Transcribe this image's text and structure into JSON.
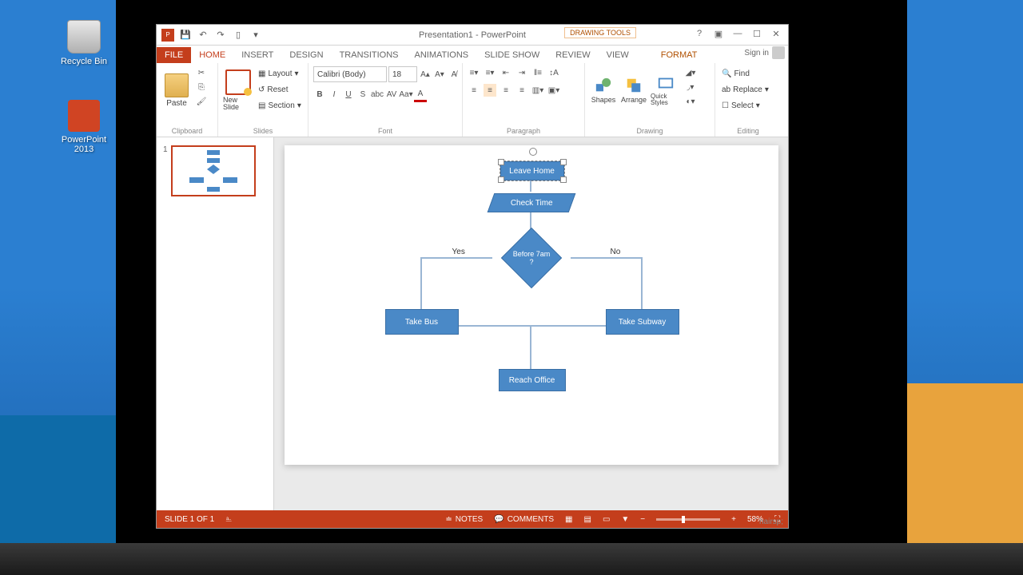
{
  "desktop": {
    "recycle_bin": "Recycle Bin",
    "powerpoint": "PowerPoint 2013"
  },
  "window": {
    "title": "Presentation1 - PowerPoint",
    "context_tools": "DRAWING TOOLS",
    "sign_in": "Sign in"
  },
  "tabs": {
    "file": "FILE",
    "home": "HOME",
    "insert": "INSERT",
    "design": "DESIGN",
    "transitions": "TRANSITIONS",
    "animations": "ANIMATIONS",
    "slideshow": "SLIDE SHOW",
    "review": "REVIEW",
    "view": "VIEW",
    "format": "FORMAT"
  },
  "ribbon": {
    "clipboard": {
      "label": "Clipboard",
      "paste": "Paste"
    },
    "slides": {
      "label": "Slides",
      "new_slide": "New Slide",
      "layout": "Layout",
      "reset": "Reset",
      "section": "Section"
    },
    "font": {
      "label": "Font",
      "name": "Calibri (Body)",
      "size": "18"
    },
    "paragraph": {
      "label": "Paragraph"
    },
    "drawing": {
      "label": "Drawing",
      "shapes": "Shapes",
      "arrange": "Arrange",
      "quick_styles": "Quick Styles"
    },
    "editing": {
      "label": "Editing",
      "find": "Find",
      "replace": "Replace",
      "select": "Select"
    }
  },
  "thumb": {
    "number": "1"
  },
  "flowchart": {
    "start": "Leave Home",
    "check": "Check Time",
    "decision": "Before 7am ?",
    "yes": "Yes",
    "no": "No",
    "left": "Take Bus",
    "right": "Take Subway",
    "end": "Reach Office"
  },
  "status": {
    "slide": "SLIDE 1 OF 1",
    "notes": "NOTES",
    "comments": "COMMENTS",
    "zoom": "58%"
  },
  "chart_data": {
    "type": "flowchart",
    "nodes": [
      {
        "id": "start",
        "type": "process",
        "label": "Leave Home"
      },
      {
        "id": "check",
        "type": "process",
        "label": "Check Time"
      },
      {
        "id": "decision",
        "type": "decision",
        "label": "Before 7am ?"
      },
      {
        "id": "bus",
        "type": "process",
        "label": "Take Bus"
      },
      {
        "id": "subway",
        "type": "process",
        "label": "Take Subway"
      },
      {
        "id": "end",
        "type": "process",
        "label": "Reach Office"
      }
    ],
    "edges": [
      {
        "from": "start",
        "to": "check"
      },
      {
        "from": "check",
        "to": "decision"
      },
      {
        "from": "decision",
        "to": "bus",
        "label": "Yes"
      },
      {
        "from": "decision",
        "to": "subway",
        "label": "No"
      },
      {
        "from": "bus",
        "to": "end"
      },
      {
        "from": "subway",
        "to": "end"
      }
    ]
  }
}
